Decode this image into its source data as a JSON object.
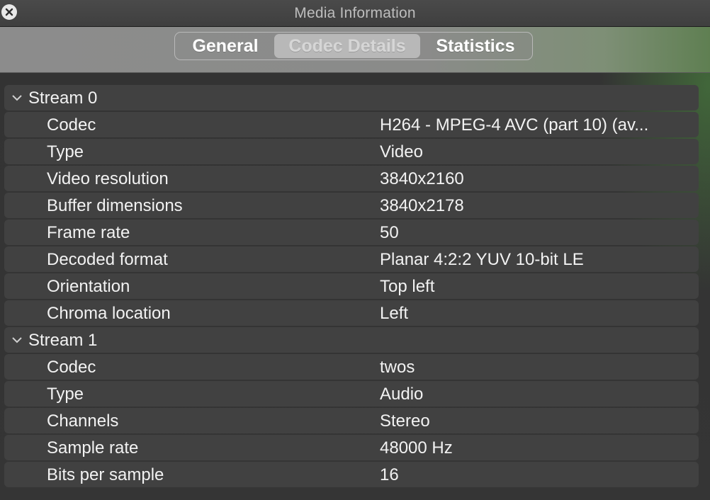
{
  "window": {
    "title": "Media Information"
  },
  "tabs": [
    {
      "label": "General",
      "selected": false
    },
    {
      "label": "Codec Details",
      "selected": true
    },
    {
      "label": "Statistics",
      "selected": false
    }
  ],
  "streams": [
    {
      "label": "Stream 0",
      "rows": [
        {
          "key": "Codec",
          "value": "H264 - MPEG-4 AVC (part 10) (av..."
        },
        {
          "key": "Type",
          "value": "Video"
        },
        {
          "key": "Video resolution",
          "value": "3840x2160"
        },
        {
          "key": "Buffer dimensions",
          "value": "3840x2178"
        },
        {
          "key": "Frame rate",
          "value": "50"
        },
        {
          "key": "Decoded format",
          "value": "Planar 4:2:2 YUV 10-bit LE"
        },
        {
          "key": "Orientation",
          "value": "Top left"
        },
        {
          "key": "Chroma location",
          "value": "Left"
        }
      ]
    },
    {
      "label": "Stream 1",
      "rows": [
        {
          "key": "Codec",
          "value": "twos"
        },
        {
          "key": "Type",
          "value": "Audio"
        },
        {
          "key": "Channels",
          "value": "Stereo"
        },
        {
          "key": "Sample rate",
          "value": "48000 Hz"
        },
        {
          "key": "Bits per sample",
          "value": "16"
        }
      ]
    }
  ],
  "icons": {
    "close": "close-icon",
    "expand": "chevron-down-icon"
  }
}
